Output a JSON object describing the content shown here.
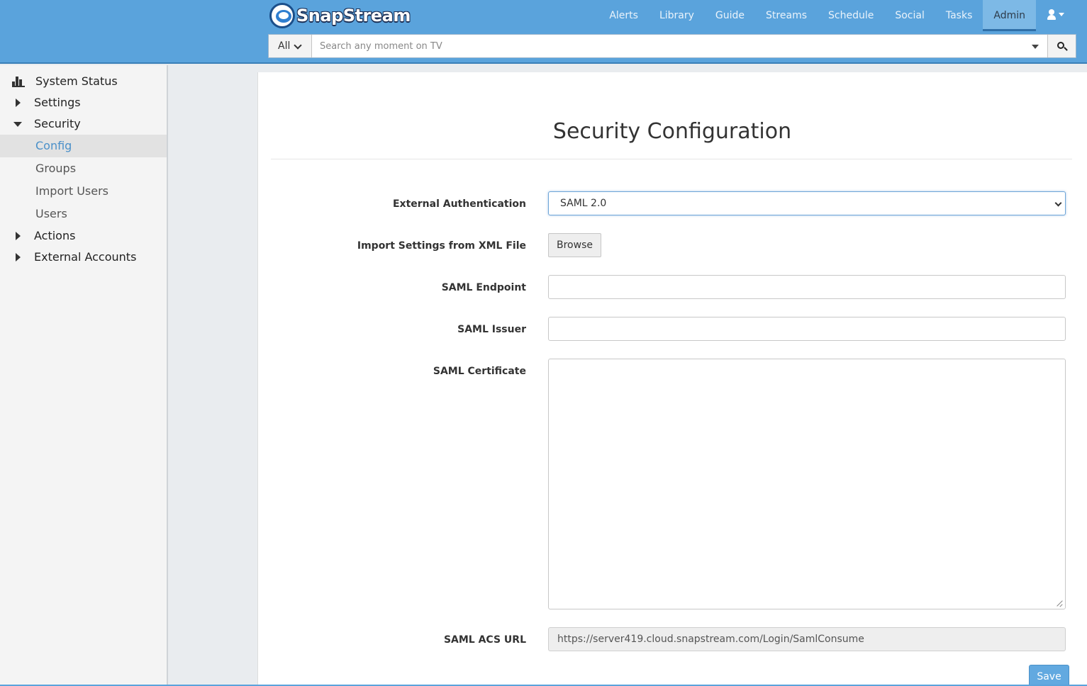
{
  "brand": {
    "name": "SnapStream"
  },
  "nav": {
    "items": [
      "Alerts",
      "Library",
      "Guide",
      "Streams",
      "Schedule",
      "Social",
      "Tasks",
      "Admin"
    ],
    "active": "Admin"
  },
  "search": {
    "scope_label": "All",
    "placeholder": "Search any moment on TV"
  },
  "sidebar": {
    "system_status": "System Status",
    "settings": "Settings",
    "security": "Security",
    "security_items": [
      "Config",
      "Groups",
      "Import Users",
      "Users"
    ],
    "active_item": "Config",
    "actions": "Actions",
    "external_accounts": "External Accounts"
  },
  "form": {
    "title": "Security Configuration",
    "external_auth_label": "External Authentication",
    "external_auth_value": "SAML 2.0",
    "import_label": "Import Settings from XML File",
    "browse_label": "Browse",
    "endpoint_label": "SAML Endpoint",
    "endpoint_value": "",
    "issuer_label": "SAML Issuer",
    "issuer_value": "",
    "certificate_label": "SAML Certificate",
    "certificate_value": "",
    "acs_label": "SAML ACS URL",
    "acs_value": "https://server419.cloud.snapstream.com/Login/SamlConsume",
    "save_label": "Save"
  },
  "colors": {
    "header": "#5aa3dc",
    "accent": "#4a90c9",
    "save_button": "#62a9e0"
  }
}
